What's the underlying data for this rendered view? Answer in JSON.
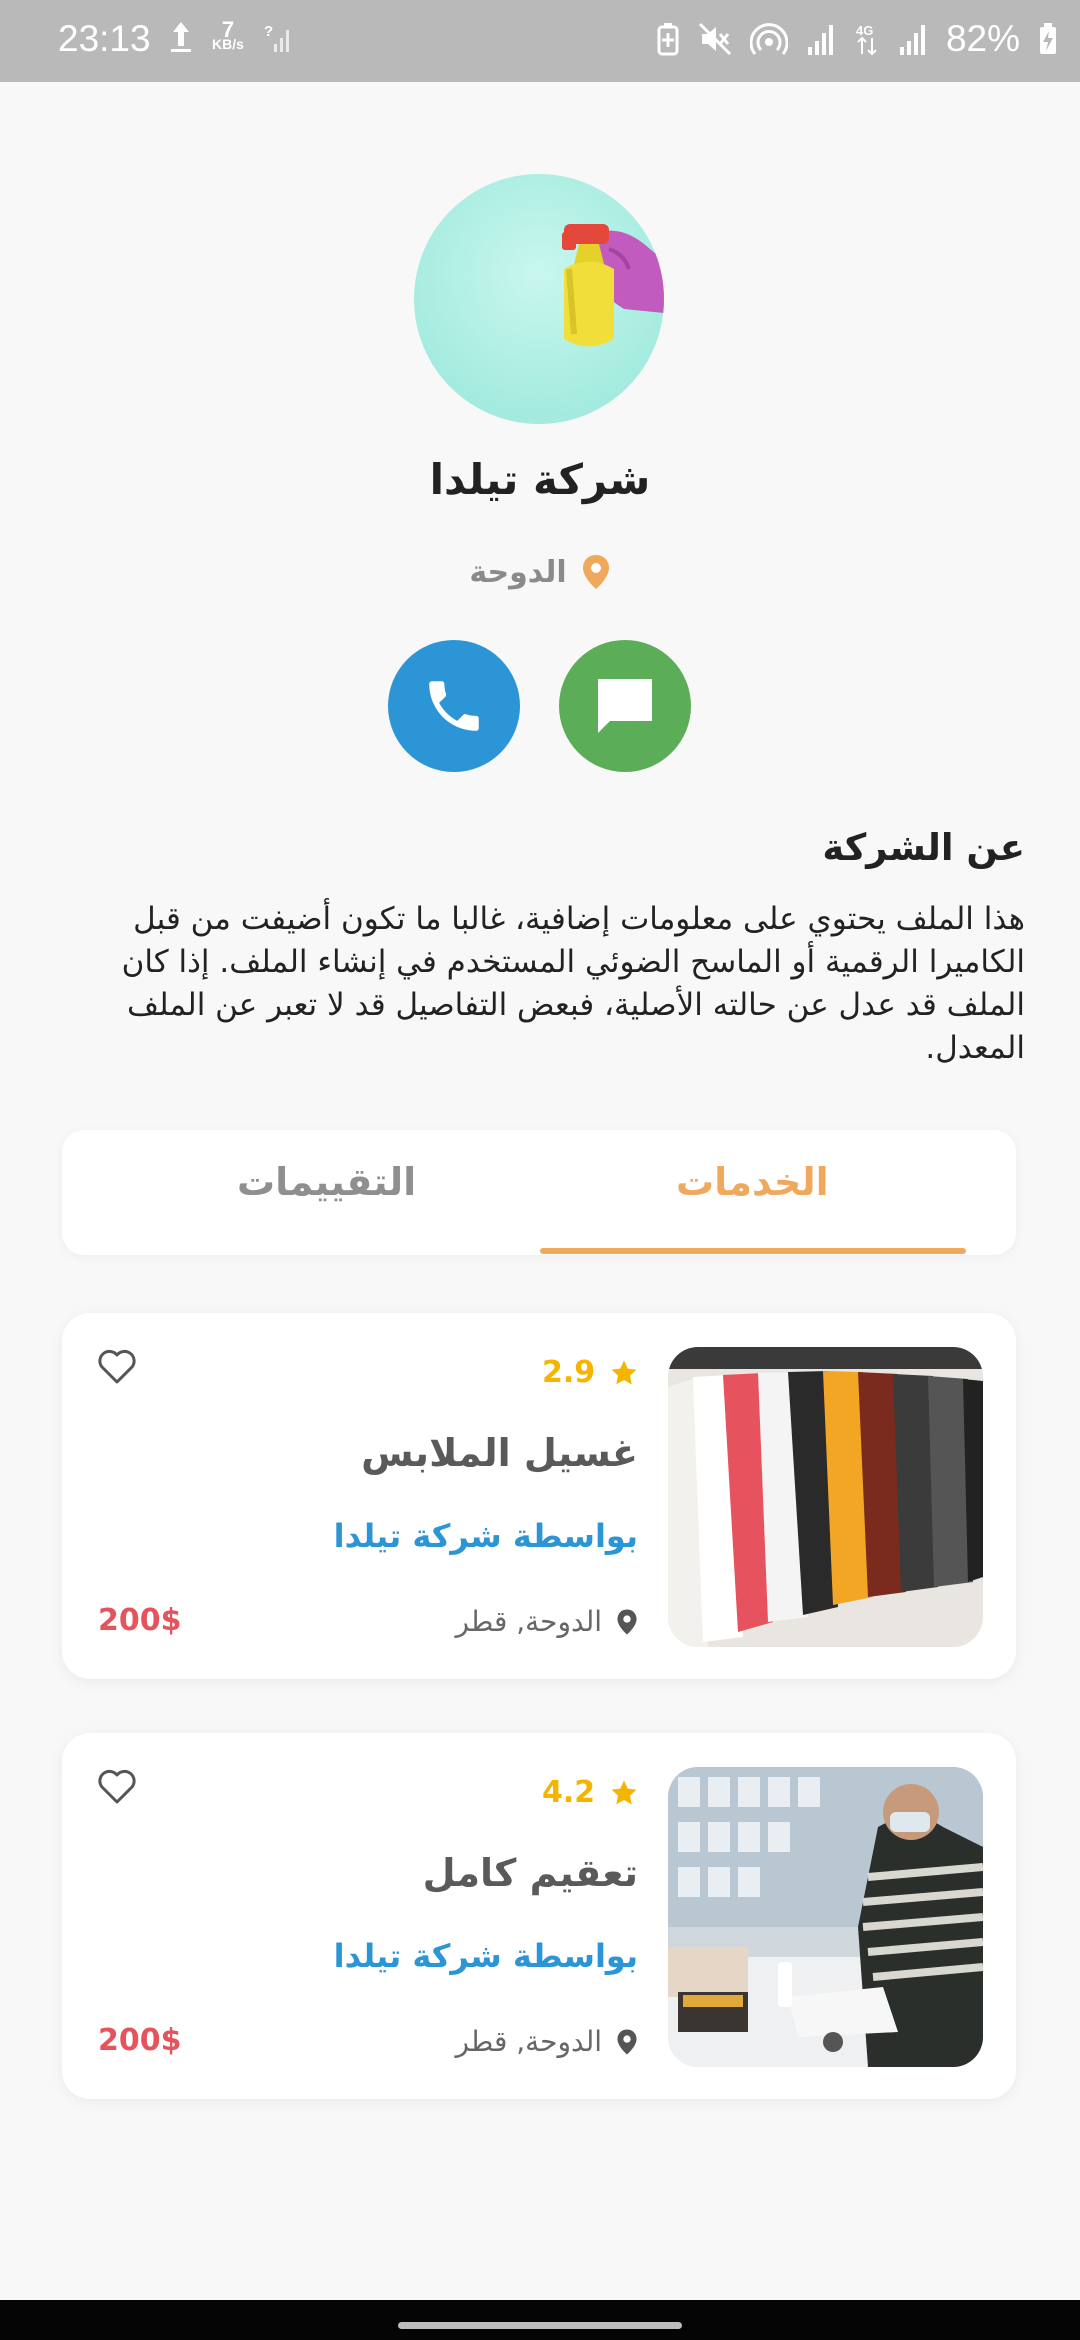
{
  "status_bar": {
    "time": "23:13",
    "net_speed_value": "7",
    "net_speed_unit": "KB/s",
    "battery": "82%",
    "icons": [
      "upload-arrow-icon",
      "signal-unknown-icon",
      "battery-saver-icon",
      "mute-icon",
      "hotspot-icon",
      "signal-icon",
      "4g-icon",
      "signal-icon",
      "battery-charging-icon"
    ]
  },
  "company": {
    "name": "شركة تيلدا",
    "location": "الدوحة"
  },
  "about": {
    "title": "عن الشركة",
    "text": "هذا الملف يحتوي على معلومات إضافية، غالبا ما تكون أضيفت من قبل الكاميرا الرقمية أو الماسح الضوئي المستخدم في إنشاء الملف.  إذا كان الملف قد عدل عن حالته الأصلية، فبعض التفاصيل قد لا تعبر عن الملف المعدل."
  },
  "tabs": [
    {
      "label": "الخدمات",
      "active": true
    },
    {
      "label": "التقييمات",
      "active": false
    }
  ],
  "services": [
    {
      "rating": "2.9",
      "title": "غسيل الملابس",
      "by": "بواسطة شركة تيلدا",
      "location": "الدوحة, قطر",
      "price": "200$"
    },
    {
      "rating": "4.2",
      "title": "تعقيم كامل",
      "by": "بواسطة شركة تيلدا",
      "location": "الدوحة, قطر",
      "price": "200$"
    }
  ],
  "colors": {
    "accent": "#f0a95c",
    "call": "#2b95d6",
    "message": "#5cad58",
    "price": "#e5535d",
    "rating": "#f5b400"
  }
}
